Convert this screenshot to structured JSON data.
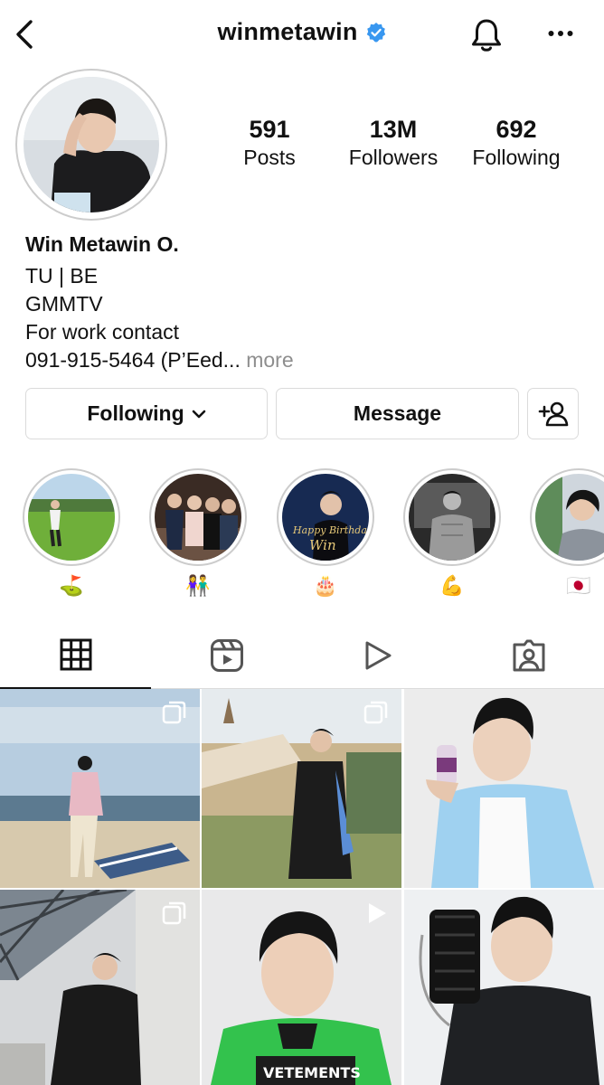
{
  "header": {
    "username": "winmetawin",
    "back_icon": "chevron-left-icon",
    "verified_icon": "verified-badge-icon",
    "bell_icon": "bell-icon",
    "more_icon": "more-horizontal-icon"
  },
  "stats": {
    "posts": {
      "value": "591",
      "label": "Posts"
    },
    "followers": {
      "value": "13M",
      "label": "Followers"
    },
    "following": {
      "value": "692",
      "label": "Following"
    }
  },
  "bio": {
    "name": "Win Metawin O.",
    "lines": [
      "TU | BE",
      "GMMTV",
      "For work contact"
    ],
    "last_line": "091-915-5464 (P’Eed...",
    "more": "more"
  },
  "buttons": {
    "following": "Following",
    "message": "Message",
    "add_user_icon": "add-user-icon"
  },
  "highlights": [
    {
      "emoji": "⛳",
      "scene": "golf"
    },
    {
      "emoji": "👫",
      "scene": "family"
    },
    {
      "emoji": "🎂",
      "scene": "birthday"
    },
    {
      "emoji": "💪",
      "scene": "gym"
    },
    {
      "emoji": "🇯🇵",
      "scene": "selfie"
    }
  ],
  "highlight_text": {
    "birthday_line1": "Happy Birthday",
    "birthday_line2": "Win"
  },
  "tabs": [
    "grid-icon",
    "reels-icon",
    "video-icon",
    "tagged-icon"
  ],
  "grid": [
    {
      "type": "carousel",
      "scene": "beach"
    },
    {
      "type": "carousel",
      "scene": "graduation"
    },
    {
      "type": "single",
      "scene": "studio-drink"
    },
    {
      "type": "carousel",
      "scene": "leather-jacket"
    },
    {
      "type": "video",
      "scene": "jersey"
    },
    {
      "type": "single",
      "scene": "bag"
    }
  ],
  "grid_text": {
    "jersey_print": "VETEMENTS"
  },
  "colors": {
    "verified": "#3897f0",
    "secondary_text": "#8e8e8e",
    "border": "#dbdbdb"
  }
}
